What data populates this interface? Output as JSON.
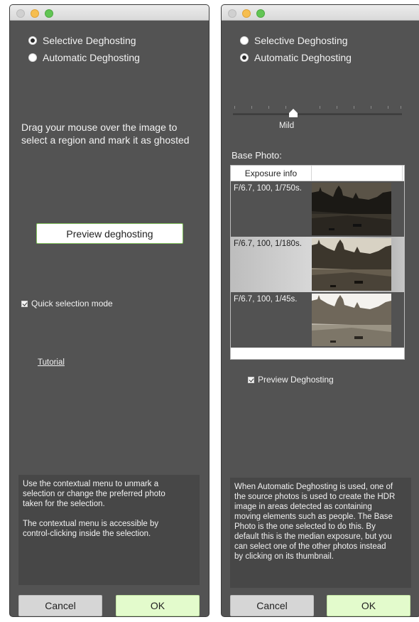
{
  "left_panel": {
    "radio_selective": "Selective Deghosting",
    "radio_automatic": "Automatic Deghosting",
    "instructions_line1": "Drag your mouse over the image to",
    "instructions_line2": "select a region and mark it as ghosted",
    "preview_button": "Preview deghosting",
    "quick_selection_label": "Quick selection mode",
    "tutorial_link": "Tutorial",
    "info_lines_1": [
      "Use the contextual menu to unmark a",
      "selection or change the preferred photo",
      "taken for the selection."
    ],
    "info_lines_2": [
      "The contextual menu is accessible by",
      "control-clicking inside the selection."
    ],
    "cancel_label": "Cancel",
    "ok_label": "OK",
    "selected_mode": "selective",
    "quick_selection_checked": true
  },
  "right_panel": {
    "radio_selective": "Selective Deghosting",
    "radio_automatic": "Automatic Deghosting",
    "slider_label": "Mild",
    "base_photo_label": "Base Photo:",
    "list_header": "Exposure info",
    "photos": [
      {
        "exposure": "F/6.7, 100, 1/750s.",
        "state": "dark-row"
      },
      {
        "exposure": "F/6.7, 100, 1/180s.",
        "state": "selected-row"
      },
      {
        "exposure": "F/6.7, 100, 1/45s.",
        "state": "dark-row"
      }
    ],
    "preview_deghosting_label": "Preview Deghosting",
    "info_lines": [
      "When Automatic Deghosting is used, one of",
      "the source photos is used to create the HDR",
      "image in areas detected as containing",
      "moving elements such as people. The Base",
      "Photo is the one selected to do this. By",
      "default this is the median exposure, but you",
      "can select one of the other photos instead",
      "by clicking on its thumbnail."
    ],
    "cancel_label": "Cancel",
    "ok_label": "OK",
    "selected_mode": "automatic",
    "preview_checked": true
  },
  "colors": {
    "panel_bg": "#535353",
    "ok_button_bg": "#e3fbcc",
    "preview_button_border": "#7fbf5a"
  },
  "icons": [
    "close-window-icon",
    "minimize-window-icon",
    "maximize-window-icon",
    "checkmark-icon",
    "slider-thumb-icon",
    "venice-canal-photo"
  ]
}
